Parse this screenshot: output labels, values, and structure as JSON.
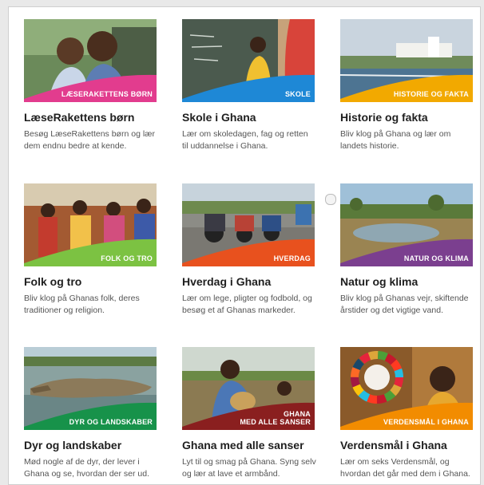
{
  "cards": [
    {
      "tag": "LÆSERAKETTENS BØRN",
      "title": "LæseRakettens børn",
      "desc": "Besøg LæseRakettens børn og lær dem endnu bedre at kende.",
      "accent": "#e23c8e"
    },
    {
      "tag": "SKOLE",
      "title": "Skole i Ghana",
      "desc": "Lær om skoledagen, fag og retten til uddannelse i Ghana.",
      "accent": "#1e88d6"
    },
    {
      "tag": "HISTORIE OG FAKTA",
      "title": "Historie og fakta",
      "desc": "Bliv klog på Ghana og lær om landets historie.",
      "accent": "#f2a900"
    },
    {
      "tag": "FOLK OG TRO",
      "title": "Folk og tro",
      "desc": "Bliv klog på Ghanas folk, deres traditioner og religion.",
      "accent": "#7cc242"
    },
    {
      "tag": "HVERDAG",
      "title": "Hverdag i Ghana",
      "desc": "Lær om lege, pligter og fodbold, og besøg et af Ghanas markeder.",
      "accent": "#e8511e"
    },
    {
      "tag": "NATUR OG KLIMA",
      "title": "Natur og klima",
      "desc": "Bliv klog på Ghanas vejr, skiftende årstider og det vigtige vand.",
      "accent": "#7b3f8f"
    },
    {
      "tag": "DYR OG LANDSKABER",
      "title": "Dyr og landskaber",
      "desc": "Mød nogle af de dyr, der lever i Ghana og se, hvordan der ser ud.",
      "accent": "#17924a"
    },
    {
      "tag_line1": "GHANA",
      "tag_line2": "MED ALLE SANSER",
      "title": "Ghana med alle sanser",
      "desc": "Lyt til og smag på Ghana. Syng selv og lær at lave et armbånd.",
      "accent": "#8a1f1f"
    },
    {
      "tag": "VERDENSMÅL I GHANA",
      "title": "Verdensmål i Ghana",
      "desc": "Lær om seks Verdensmål, og hvordan det går med dem i Ghana.",
      "accent": "#f28c00"
    }
  ]
}
